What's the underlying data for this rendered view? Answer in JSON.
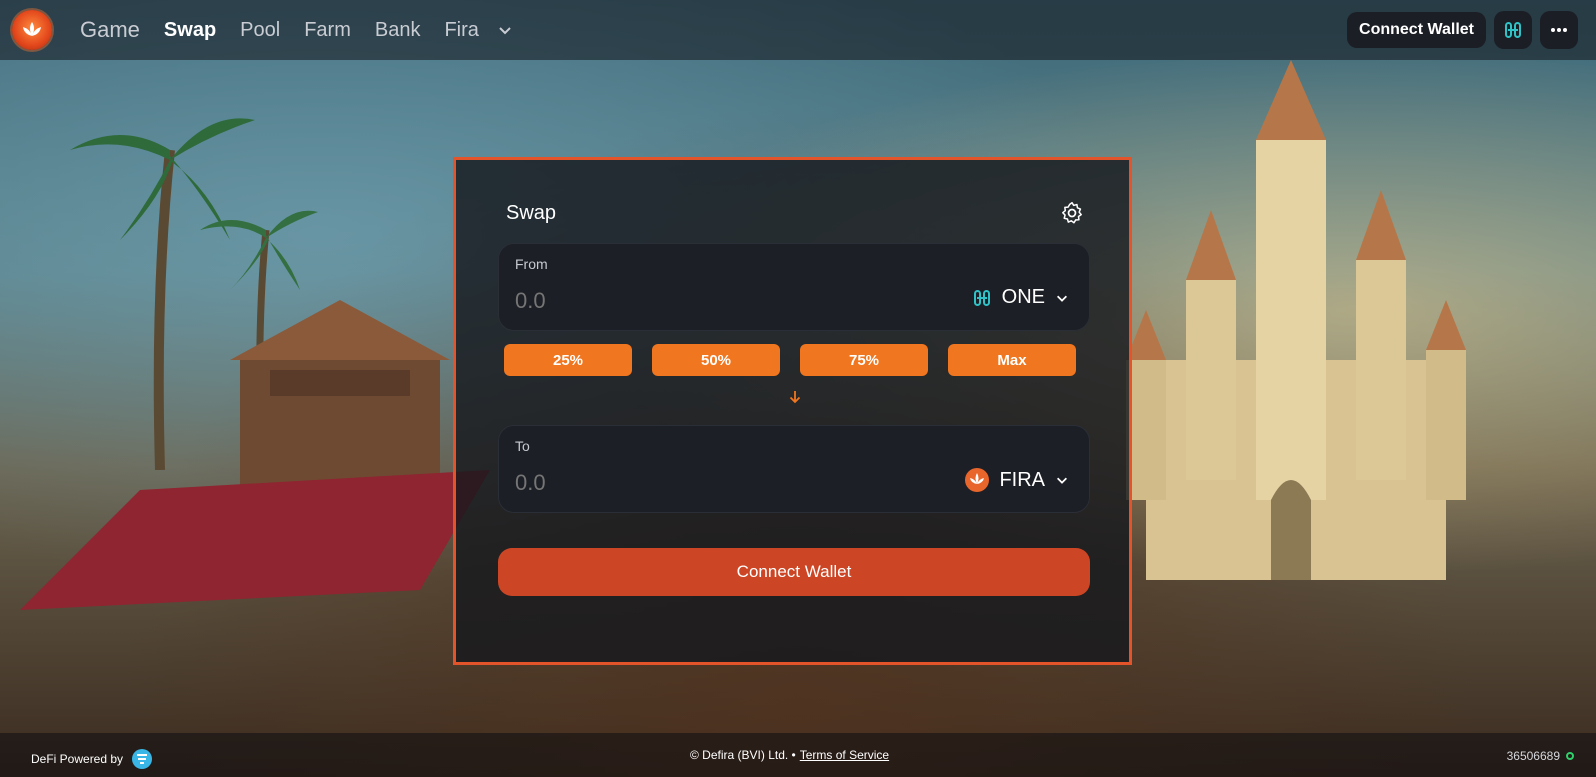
{
  "nav": {
    "items": [
      {
        "label": "Game",
        "active": false
      },
      {
        "label": "Swap",
        "active": true
      },
      {
        "label": "Pool",
        "active": false
      },
      {
        "label": "Farm",
        "active": false
      },
      {
        "label": "Bank",
        "active": false
      },
      {
        "label": "Fira",
        "active": false
      }
    ],
    "more_icon": "chevron-down-icon"
  },
  "topbar": {
    "connect_label": "Connect Wallet",
    "network_icon": "harmony-one-icon",
    "menu_icon": "more-horizontal-icon"
  },
  "swap": {
    "title": "Swap",
    "from": {
      "label": "From",
      "placeholder": "0.0",
      "token": "ONE",
      "token_icon": "harmony-one-icon"
    },
    "to": {
      "label": "To",
      "placeholder": "0.0",
      "token": "FIRA",
      "token_icon": "fira-icon"
    },
    "percent_buttons": [
      "25%",
      "50%",
      "75%",
      "Max"
    ],
    "connect_label": "Connect Wallet"
  },
  "footer": {
    "powered_by": "DeFi Powered by",
    "copyright": "© Defira (BVI) Ltd. •",
    "terms": "Terms of Service",
    "block_number": "36506689"
  },
  "colors": {
    "accent": "#f0761f",
    "frame": "#e4542a",
    "connect": "#cc4524",
    "one_teal": "#2fc3c7",
    "status": "#2fd16b"
  }
}
